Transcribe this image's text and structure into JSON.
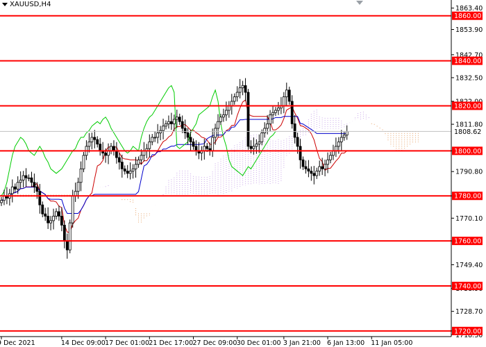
{
  "chart_data": {
    "type": "candlestick",
    "title": "XAUUSD,H4",
    "symbol": "XAUUSD",
    "timeframe": "H4",
    "ylim": [
      1717.5,
      1867.0
    ],
    "current_price": 1808.62,
    "price_ticks": [
      "1863.40",
      "1853.90",
      "1842.70",
      "1832.50",
      "1822.00",
      "1811.80",
      "1800.00",
      "1790.80",
      "1780.00",
      "1770.10",
      "1760.00",
      "1749.40",
      "1738.90",
      "1728.70",
      "1720.00",
      "1718.30"
    ],
    "price_tick_values": [
      1863.4,
      1853.9,
      1842.7,
      1832.5,
      1822.0,
      1811.8,
      1800.0,
      1790.8,
      1780.0,
      1770.1,
      1760.0,
      1749.4,
      1738.9,
      1728.7,
      1720.0,
      1718.3
    ],
    "levels": [
      {
        "label": "1860.00",
        "value": 1860.0
      },
      {
        "label": "1840.00",
        "value": 1840.0
      },
      {
        "label": "1820.00",
        "value": 1820.0
      },
      {
        "label": "1800.00",
        "value": 1800.0
      },
      {
        "label": "1780.00",
        "value": 1780.0
      },
      {
        "label": "1760.00",
        "value": 1760.0
      },
      {
        "label": "1740.00",
        "value": 1740.0
      },
      {
        "label": "1720.00",
        "value": 1720.0
      }
    ],
    "time_labels": [
      {
        "label": "9 Dec 2021",
        "index": 0
      },
      {
        "label": "14 Dec 09:00",
        "index": 22
      },
      {
        "label": "17 Dec 01:00",
        "index": 38
      },
      {
        "label": "21 Dec 17:00",
        "index": 54
      },
      {
        "label": "27 Dec 09:00",
        "index": 70
      },
      {
        "label": "30 Dec 01:00",
        "index": 86
      },
      {
        "label": "3 Jan 21:00",
        "index": 103
      },
      {
        "label": "6 Jan 13:00",
        "index": 119
      },
      {
        "label": "11 Jan 05:00",
        "index": 135
      }
    ],
    "close": [
      1778,
      1780,
      1779,
      1781,
      1784,
      1783,
      1786,
      1787,
      1789,
      1788,
      1788,
      1786,
      1784,
      1782,
      1776,
      1772,
      1771,
      1768,
      1769,
      1771,
      1773,
      1771,
      1767,
      1760,
      1756,
      1768,
      1780,
      1782,
      1786,
      1792,
      1798,
      1802,
      1804,
      1806,
      1805,
      1803,
      1800,
      1799,
      1798,
      1800,
      1802,
      1800,
      1797,
      1795,
      1792,
      1791,
      1790,
      1791,
      1792,
      1794,
      1796,
      1798,
      1800,
      1801,
      1804,
      1806,
      1806,
      1808,
      1809,
      1811,
      1812,
      1813,
      1812,
      1814,
      1815,
      1813,
      1810,
      1808,
      1806,
      1804,
      1802,
      1800,
      1799,
      1800,
      1802,
      1801,
      1800,
      1806,
      1810,
      1813,
      1815,
      1816,
      1818,
      1820,
      1822,
      1824,
      1826,
      1828,
      1829,
      1826,
      1802,
      1801,
      1802,
      1803,
      1804,
      1808,
      1810,
      1812,
      1816,
      1817,
      1818,
      1819,
      1820,
      1824,
      1827,
      1822,
      1812,
      1806,
      1802,
      1796,
      1793,
      1792,
      1791,
      1790,
      1789,
      1791,
      1793,
      1792,
      1794,
      1796,
      1798,
      1800,
      1802,
      1804,
      1806,
      1807,
      1808.62
    ]
  }
}
